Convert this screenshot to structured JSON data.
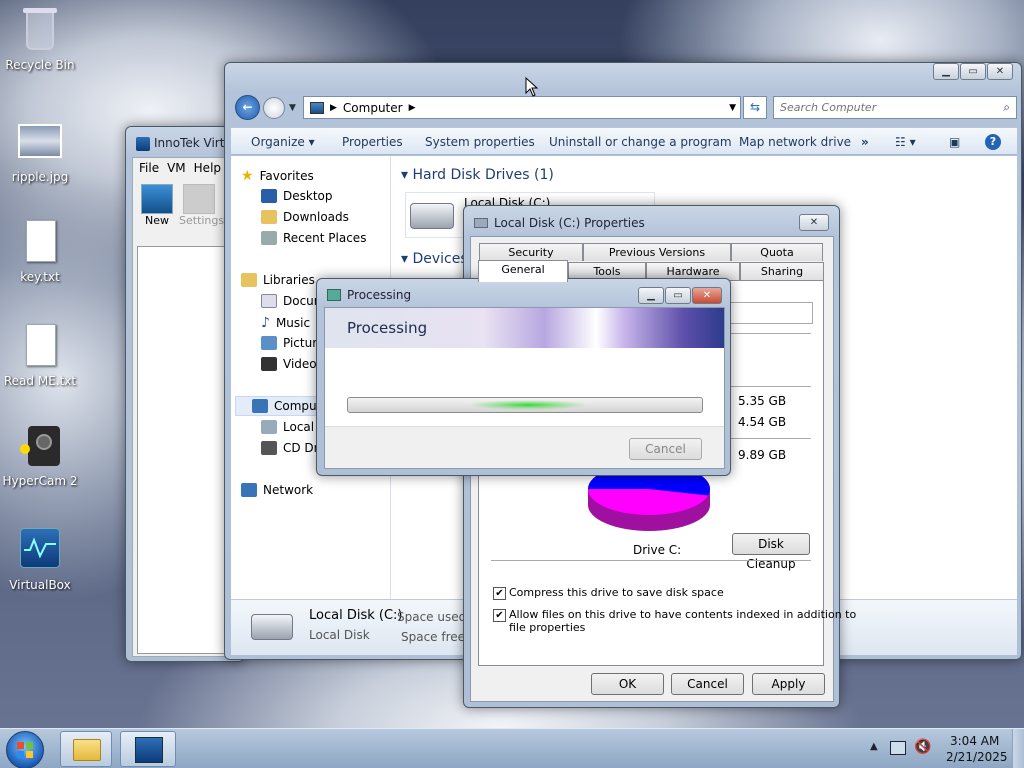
{
  "desktop": {
    "icons": [
      {
        "label": "Recycle Bin"
      },
      {
        "label": "ripple.jpg"
      },
      {
        "label": "key.txt"
      },
      {
        "label": "Read ME.txt"
      },
      {
        "label": "HyperCam 2"
      },
      {
        "label": "VirtualBox"
      }
    ]
  },
  "vbox": {
    "title": "InnoTek Virt",
    "menu": [
      "File",
      "VM",
      "Help"
    ],
    "toolbar": {
      "new": "New",
      "settings": "Settings"
    }
  },
  "explorer": {
    "address": {
      "path": "Computer"
    },
    "search": {
      "placeholder": "Search Computer"
    },
    "toolbar": {
      "organize": "Organize",
      "properties": "Properties",
      "system_properties": "System properties",
      "uninstall": "Uninstall or change a program",
      "map_drive": "Map network drive",
      "more": "»"
    },
    "nav": {
      "favorites": "Favorites",
      "desktop": "Desktop",
      "downloads": "Downloads",
      "recent": "Recent Places",
      "libraries": "Libraries",
      "documents": "Docur",
      "music": "Music",
      "pictures": "Picture",
      "videos": "Videos",
      "computer": "Comput",
      "local_disk": "Local",
      "cd_drive": "CD Dri",
      "network": "Network"
    },
    "sections": {
      "hard_disks": "Hard Disk Drives (1)",
      "devices": "Devices"
    },
    "drive_label": "Local Disk (C:)",
    "details": {
      "name": "Local Disk (C:)",
      "type": "Local Disk",
      "space_used_label": "Space used:",
      "space_free_label": "Space free:"
    }
  },
  "properties": {
    "title": "Local Disk (C:) Properties",
    "tabs_back": [
      "Security",
      "Previous Versions",
      "Quota"
    ],
    "tabs_front": [
      "General",
      "Tools",
      "Hardware",
      "Sharing"
    ],
    "used": "5.35 GB",
    "free": "4.54 GB",
    "capacity": "9.89 GB",
    "drive": "Drive C:",
    "disk_cleanup": "Disk Cleanup",
    "compress": "Compress this drive to save disk space",
    "index_1": "Allow files on this drive to have contents indexed in addition to",
    "index_2": "file properties",
    "ok": "OK",
    "cancel": "Cancel",
    "apply": "Apply",
    "used_fraction": 0.54
  },
  "processing": {
    "title": "Processing",
    "heading": "Processing",
    "cancel": "Cancel"
  },
  "taskbar": {
    "time": "3:04 AM",
    "date": "2/21/2025"
  }
}
